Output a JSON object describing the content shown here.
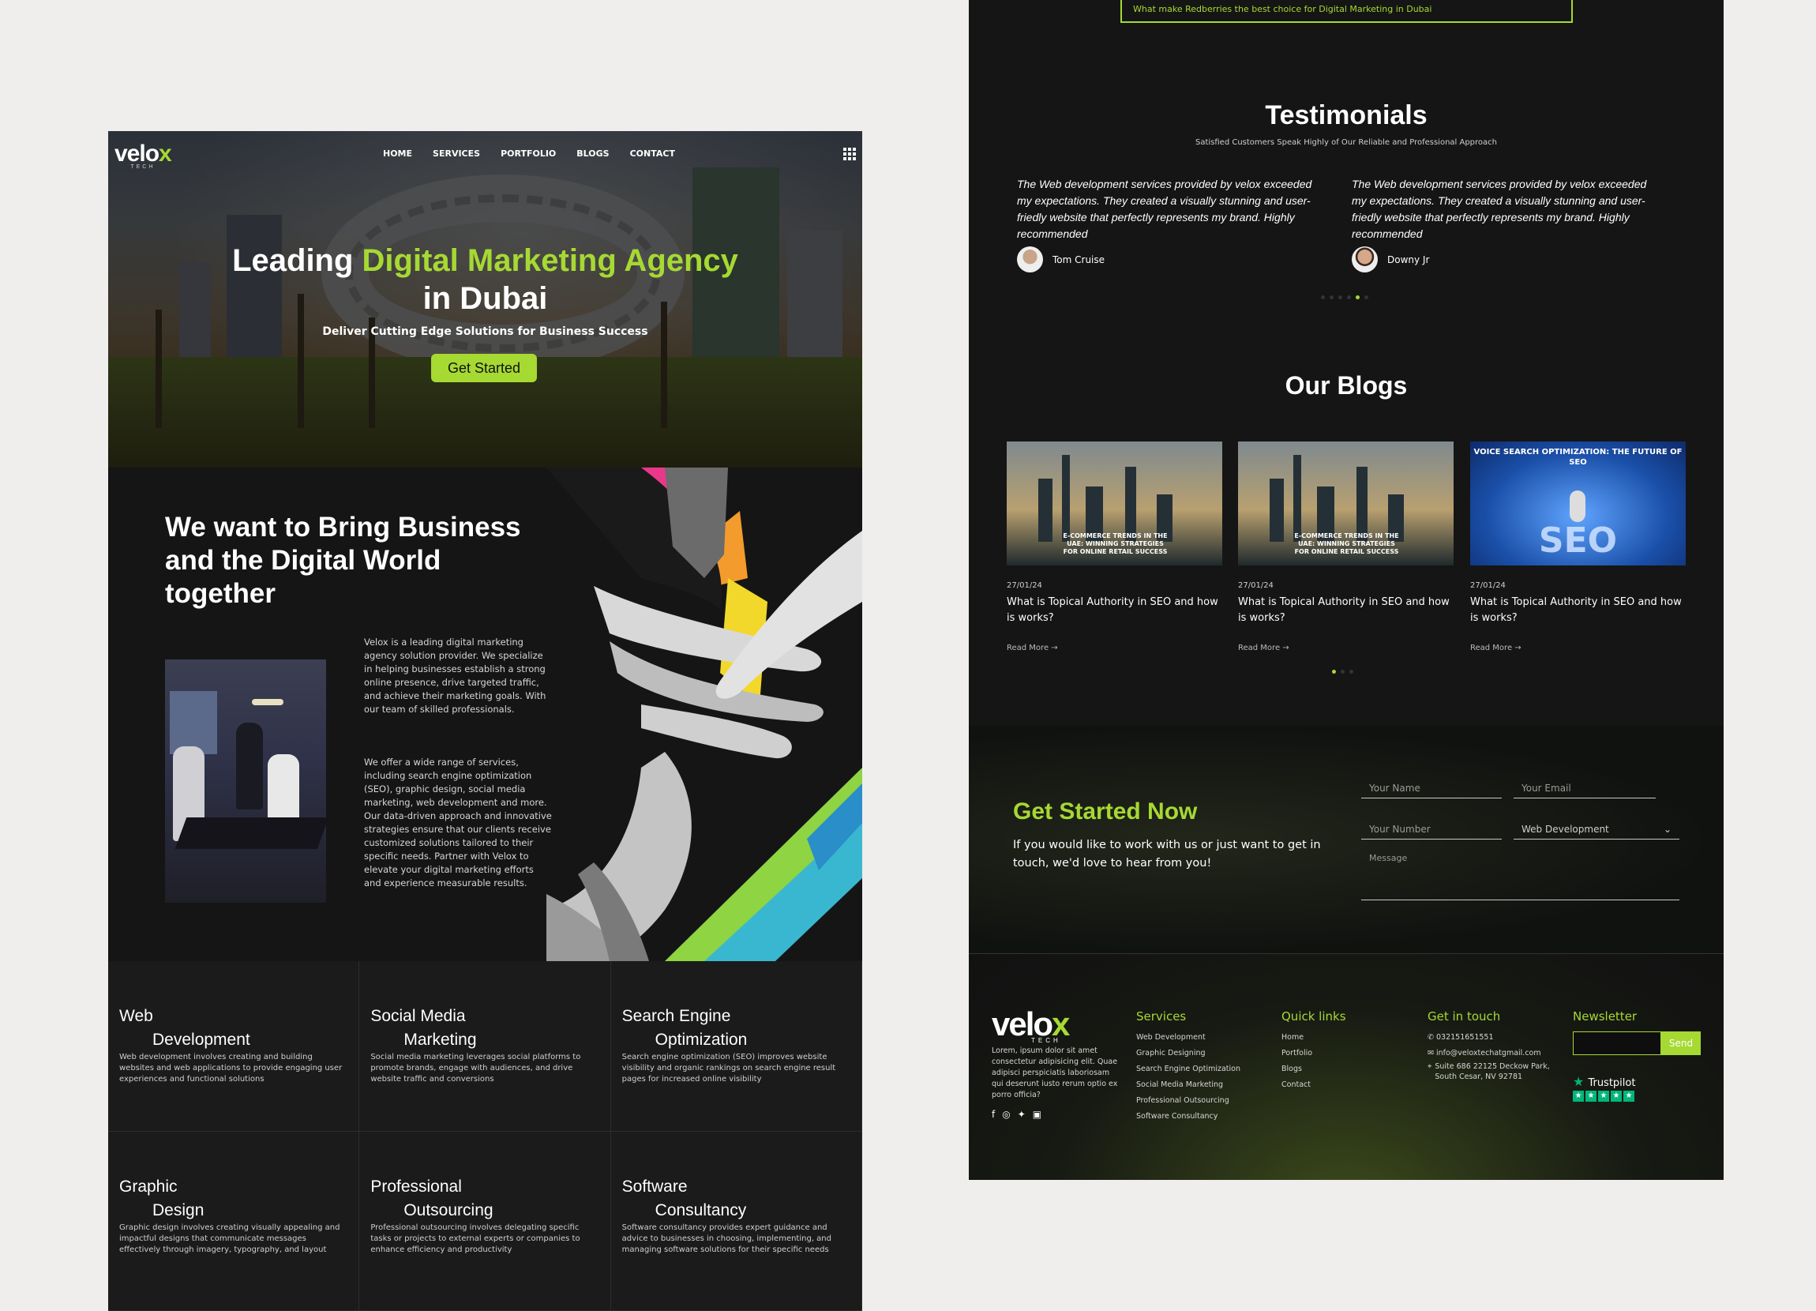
{
  "colors": {
    "accent": "#a6d932",
    "dark": "#151515"
  },
  "left": {
    "logo": {
      "text": "velo",
      "accent": "x",
      "sub": "TECH"
    },
    "nav": [
      "HOME",
      "SERVICES",
      "PORTFOLIO",
      "BLOGS",
      "CONTACT"
    ],
    "hero": {
      "title_pre": "Leading ",
      "title_accent": "Digital Marketing Agency",
      "title_post": "in Dubai",
      "subtitle": "Deliver Cutting Edge Solutions for Business Success",
      "cta": "Get Started"
    },
    "about": {
      "title": "We want to Bring Business and the Digital World together",
      "p1": "Velox is a leading digital marketing agency solution provider. We specialize in helping businesses establish a strong online presence, drive targeted traffic, and achieve their marketing goals. With our team of skilled professionals.",
      "p2": "We offer a wide range of services, including search engine optimization (SEO), graphic design, social media marketing, web development and more. Our data-driven approach and innovative strategies ensure that our clients receive customized solutions tailored to their specific needs. Partner with Velox to elevate your digital marketing efforts and experience measurable results."
    },
    "services": [
      {
        "l1": "Web",
        "l2": "Development",
        "desc": "Web development involves creating and building websites and web applications to provide engaging user experiences and functional solutions"
      },
      {
        "l1": "Social Media",
        "l2": "Marketing",
        "desc": "Social media marketing leverages social platforms to promote brands, engage with audiences, and drive website traffic and conversions"
      },
      {
        "l1": "Search Engine",
        "l2": "Optimization",
        "desc": "Search engine optimization (SEO) improves website visibility and organic rankings on search engine result pages for increased online visibility"
      },
      {
        "l1": "Graphic",
        "l2": "Design",
        "desc": "Graphic design involves creating visually appealing and impactful designs that communicate messages effectively through imagery, typography, and layout"
      },
      {
        "l1": "Professional",
        "l2": "Outsourcing",
        "desc": "Professional outsourcing involves delegating specific tasks or projects to external experts or companies to enhance efficiency and productivity"
      },
      {
        "l1": "Software",
        "l2": "Consultancy",
        "desc": "Software consultancy provides expert guidance and advice to businesses in choosing, implementing, and managing software solutions for their specific needs"
      }
    ]
  },
  "right": {
    "faq_item": "What make Redberries the best choice for Digital Marketing in Dubai",
    "testimonials": {
      "title": "Testimonials",
      "subtitle": "Satisfied Customers Speak Highly of Our Reliable and Professional Approach",
      "items": [
        {
          "quote": "The Web development services provided by velox exceeded my expectations. They created a visually stunning and user-friedly website that perfectly represents my brand. Highly recommended",
          "name": "Tom Cruise"
        },
        {
          "quote": "The Web development services provided by velox exceeded my expectations. They created a visually stunning and user-friedly website that perfectly represents my brand. Highly recommended",
          "name": "Downy Jr"
        }
      ]
    },
    "blogs": {
      "title": "Our Blogs",
      "items": [
        {
          "image_caption": "E-COMMERCE TRENDS IN THE UAE: WINNING STRATEGIES FOR ONLINE RETAIL SUCCESS",
          "date": "27/01/24",
          "title": "What is Topical Authority in SEO and how is works?",
          "more": "Read More →"
        },
        {
          "image_caption": "E-COMMERCE TRENDS IN THE UAE: WINNING STRATEGIES FOR ONLINE RETAIL SUCCESS",
          "date": "27/01/24",
          "title": "What is Topical Authority in SEO and how is works?",
          "more": "Read More →"
        },
        {
          "image_caption": "VOICE SEARCH OPTIMIZATION: THE FUTURE OF SEO",
          "image_word": "SEO",
          "date": "27/01/24",
          "title": "What is Topical Authority in SEO and how is works?",
          "more": "Read More →"
        }
      ]
    },
    "cta": {
      "title": "Get Started Now",
      "text": "If you would like to work with us or just want to get in touch, we'd love to hear from you!",
      "name_ph": "Your Name",
      "email_ph": "Your Email",
      "number_ph": "Your Number",
      "service_value": "Web Development",
      "message_ph": "Message"
    },
    "footer": {
      "logo": {
        "text": "velo",
        "accent": "x",
        "sub": "TECH"
      },
      "about": "Lorem, ipsum dolor sit amet consectetur adipisicing elit. Quae adipisci perspiciatis laboriosam qui deserunt iusto rerum optio ex porro officia?",
      "services_title": "Services",
      "services": [
        "Web Development",
        "Graphic Designing",
        "Search Engine Optimization",
        "Social Media Marketing",
        "Professional Outsourcing",
        "Software Consultancy"
      ],
      "links_title": "Quick links",
      "links": [
        "Home",
        "Portfolio",
        "Blogs",
        "Contact"
      ],
      "contact_title": "Get in touch",
      "phone": "032151651551",
      "email": "info@veloxtechatgmail.com",
      "address": "Suite 686 22125 Deckow Park, South Cesar, NV 92781",
      "newsletter_title": "Newsletter",
      "send": "Send",
      "trust": "Trustpilot"
    }
  }
}
